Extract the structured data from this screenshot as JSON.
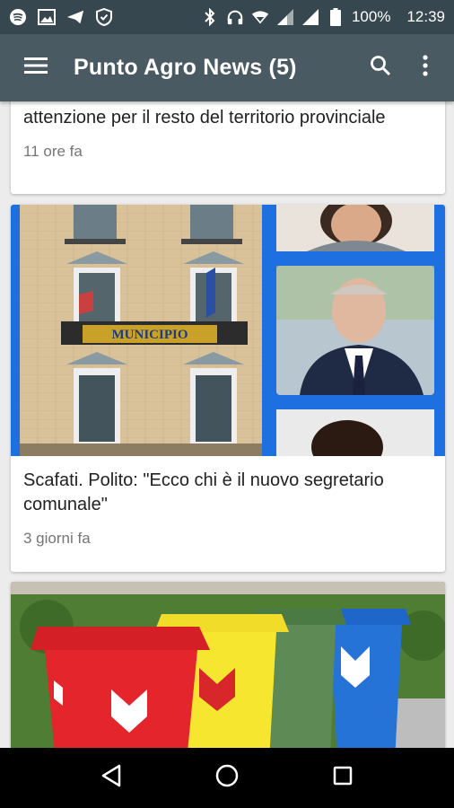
{
  "status_bar": {
    "battery": "100%",
    "time": "12:39"
  },
  "app_bar": {
    "title": "Punto Agro News (5)"
  },
  "feed": {
    "items": [
      {
        "title": "attenzione per il resto del territorio provinciale",
        "time": "11 ore fa"
      },
      {
        "title": "Scafati. Polito: \"Ecco chi è il nuovo segretario comunale\"",
        "time": "3 giorni fa",
        "image_sign": "MUNICIPIO"
      },
      {
        "title": "",
        "time": ""
      }
    ]
  },
  "colors": {
    "status_bar": "#37474f",
    "app_bar": "#4a5a62",
    "background": "#ececec",
    "nav_bar": "#000000"
  }
}
